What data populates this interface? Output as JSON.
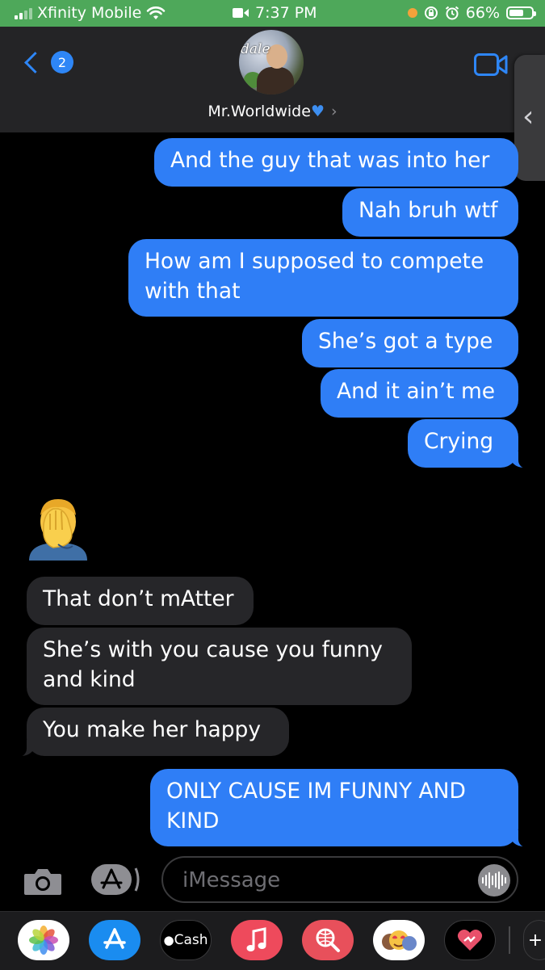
{
  "status_bar": {
    "carrier": "Xfinity Mobile",
    "time": "7:37 PM",
    "battery_percent": "66%",
    "battery_level": 0.66
  },
  "header": {
    "back_count": "2",
    "contact_name": "Mr.Worldwide",
    "avatar_tag": "dale",
    "icons": [
      "chevron-left-icon",
      "video-camera-icon",
      "chevron-right-icon"
    ]
  },
  "messages": [
    {
      "side": "sent",
      "text": "And the guy that was into her"
    },
    {
      "side": "sent",
      "text": "Nah bruh wtf"
    },
    {
      "side": "sent",
      "lines": [
        "How am I supposed to compete",
        "with that"
      ]
    },
    {
      "side": "sent",
      "text": "She’s got a type"
    },
    {
      "side": "sent",
      "text": "And it ain’t me"
    },
    {
      "side": "sent",
      "text": "Crying"
    },
    {
      "side": "received",
      "emoji": "face-palm"
    },
    {
      "side": "received",
      "text": "That don’t mAtter"
    },
    {
      "side": "received",
      "lines": [
        "She’s with you cause you funny",
        "and kind"
      ]
    },
    {
      "side": "received",
      "text": "You make her happy"
    },
    {
      "side": "sent",
      "lines": [
        "ONLY CAUSE IM FUNNY AND",
        "KIND"
      ]
    }
  ],
  "input": {
    "placeholder": "iMessage"
  },
  "app_drawer": {
    "cash_label": "Cash",
    "apps": [
      "photos-icon",
      "app-store-icon",
      "apple-cash-icon",
      "music-icon",
      "web-search-icon",
      "memoji-icon",
      "heart-app-icon"
    ]
  },
  "colors": {
    "sent_bubble": "#2f7ef6",
    "received_bubble": "#262629",
    "status_bar": "#4ea85a",
    "accent": "#2e86f6"
  }
}
